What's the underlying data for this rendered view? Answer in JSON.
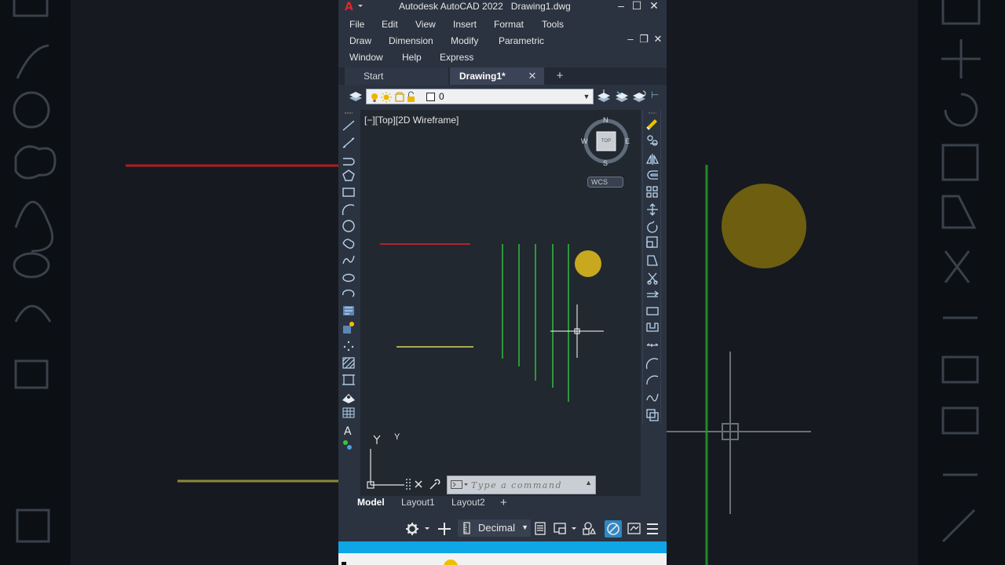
{
  "window": {
    "app_name": "Autodesk AutoCAD 2022",
    "file_name": "Drawing1.dwg",
    "minimize": "–",
    "maximize": "☐",
    "close": "✕"
  },
  "menu": {
    "row1": [
      "File",
      "Edit",
      "View",
      "Insert",
      "Format",
      "Tools"
    ],
    "row2": [
      "Draw",
      "Dimension",
      "Modify",
      "Parametric"
    ],
    "row3": [
      "Window",
      "Help",
      "Express"
    ]
  },
  "doc_controls": {
    "minimize": "–",
    "restore": "❐",
    "close": "✕"
  },
  "tabs": {
    "start": "Start",
    "active": "Drawing1*",
    "close": "✕",
    "add": "+"
  },
  "layer": {
    "current": "0"
  },
  "viewport": {
    "label": "[−][Top][2D Wireframe]",
    "viewcube": {
      "top": "TOP",
      "n": "N",
      "s": "S",
      "e": "E",
      "w": "W",
      "wcs": "WCS"
    },
    "ucs_y": "Y"
  },
  "command": {
    "placeholder": "Type a command"
  },
  "layout_tabs": [
    "Model",
    "Layout1",
    "Layout2"
  ],
  "layout_add": "+",
  "status": {
    "units": "Decimal"
  },
  "colors": {
    "red_line": "#e0262a",
    "yellow_line": "#d9d45e",
    "green_line": "#35c93a",
    "circle": "#c8a81e",
    "accent_blue": "#0ea6e6",
    "bg": "#212830"
  }
}
